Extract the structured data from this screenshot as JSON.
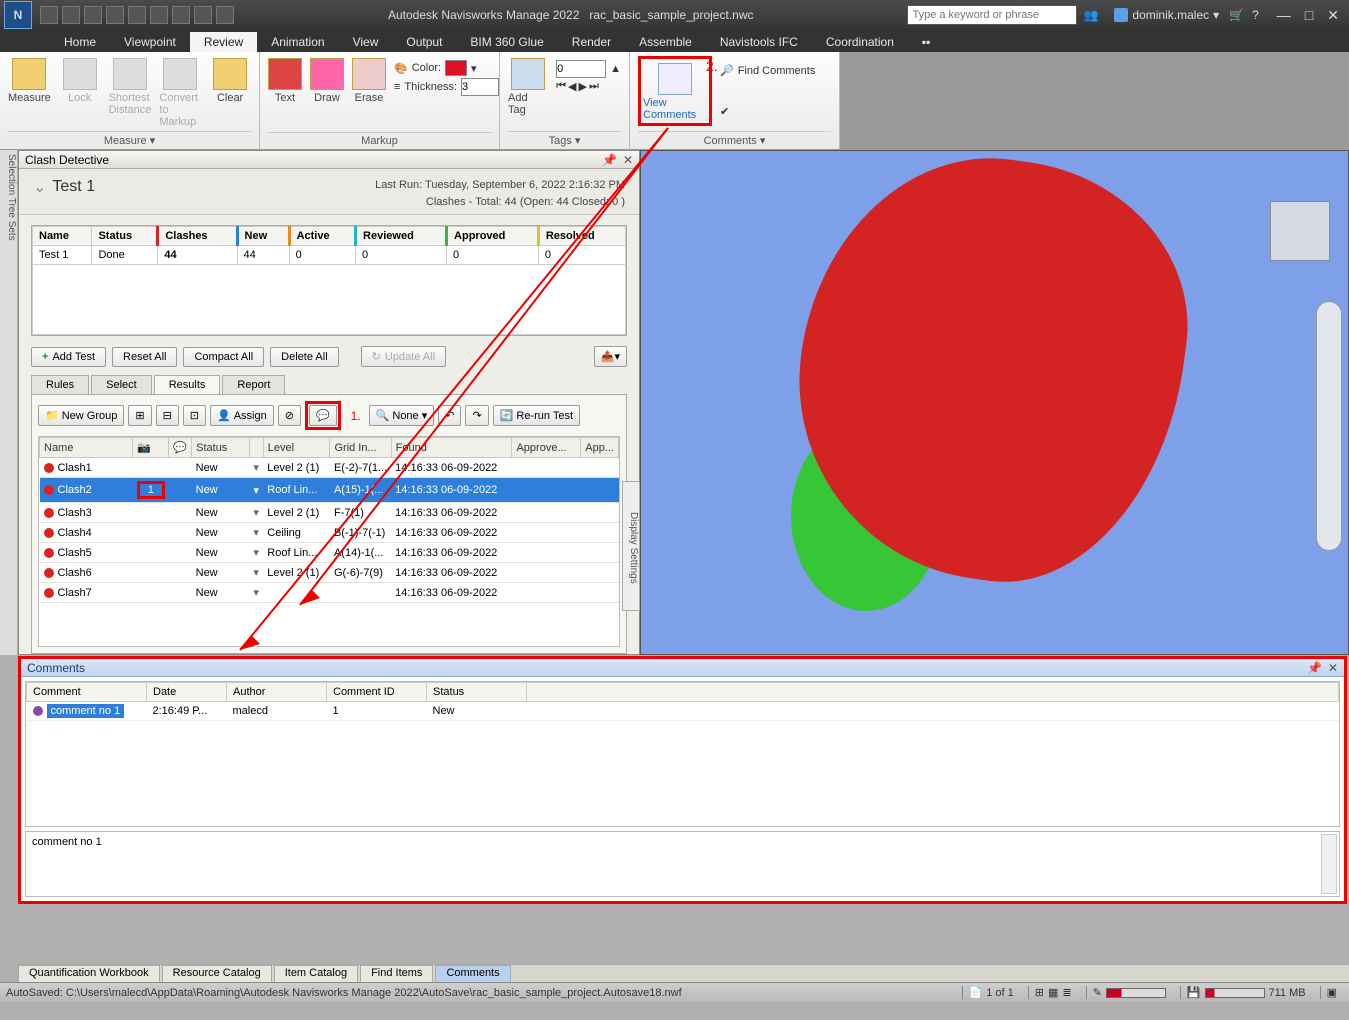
{
  "titlebar": {
    "app": "Autodesk Navisworks Manage 2022",
    "file": "rac_basic_sample_project.nwc",
    "search_placeholder": "Type a keyword or phrase",
    "user": "dominik.malec"
  },
  "menutabs": [
    "Home",
    "Viewpoint",
    "Review",
    "Animation",
    "View",
    "Output",
    "BIM 360 Glue",
    "Render",
    "Assemble",
    "Navistools IFC",
    "Coordination"
  ],
  "menutabs_active": "Review",
  "ribbon": {
    "measure": {
      "label": "Measure ▾",
      "btn_measure": "Measure",
      "btn_lock": "Lock",
      "btn_shortest": "Shortest Distance",
      "btn_convert": "Convert to Markup",
      "btn_clear": "Clear"
    },
    "markup": {
      "label": "Markup",
      "btn_text": "Text",
      "btn_draw": "Draw",
      "btn_erase": "Erase",
      "color": "Color:",
      "thickness": "Thickness:",
      "thickness_val": "3"
    },
    "tags": {
      "label": "Tags ▾",
      "btn_add": "Add Tag",
      "counter": "0"
    },
    "comments": {
      "label": "Comments ▾",
      "btn_view": "View Comments",
      "btn_find": "Find Comments"
    }
  },
  "side_strip": "Selection Tree   Sets",
  "clash": {
    "title": "Clash Detective",
    "test_name": "Test 1",
    "last_run": "Last Run:  Tuesday, September 6, 2022 2:16:32 PM",
    "totals": "Clashes - Total: 44  (Open: 44  Closed: 0 )",
    "summary_headers": [
      "Name",
      "Status",
      "Clashes",
      "New",
      "Active",
      "Reviewed",
      "Approved",
      "Resolved"
    ],
    "summary_row": [
      "Test 1",
      "Done",
      "44",
      "44",
      "0",
      "0",
      "0",
      "0"
    ],
    "btn_add": "Add Test",
    "btn_reset": "Reset All",
    "btn_compact": "Compact All",
    "btn_delete": "Delete All",
    "btn_update": "Update All",
    "tabs": [
      "Rules",
      "Select",
      "Results",
      "Report"
    ],
    "tabs_active": "Results",
    "btn_newgroup": "New Group",
    "btn_assign": "Assign",
    "btn_none": "None ▾",
    "btn_rerun": "Re-run Test",
    "grid_headers": [
      "Name",
      "📷",
      "💬",
      "Status",
      "",
      "Level",
      "Grid In...",
      "Found",
      "Approve...",
      "App..."
    ],
    "rows": [
      {
        "name": "Clash1",
        "cam": "",
        "c": "",
        "status": "New",
        "level": "Level 2 (1)",
        "grid": "E(-2)-7(1...",
        "found": "14:16:33 06-09-2022"
      },
      {
        "name": "Clash2",
        "cam": "1",
        "c": "",
        "status": "New",
        "level": "Roof Lin...",
        "grid": "A(15)-1(...",
        "found": "14:16:33 06-09-2022",
        "sel": true
      },
      {
        "name": "Clash3",
        "cam": "",
        "c": "",
        "status": "New",
        "level": "Level 2 (1)",
        "grid": "F-7(1)",
        "found": "14:16:33 06-09-2022"
      },
      {
        "name": "Clash4",
        "cam": "",
        "c": "",
        "status": "New",
        "level": "Ceiling",
        "grid": "B(-1)-7(-1)",
        "found": "14:16:33 06-09-2022"
      },
      {
        "name": "Clash5",
        "cam": "",
        "c": "",
        "status": "New",
        "level": "Roof Lin...",
        "grid": "A(14)-1(...",
        "found": "14:16:33 06-09-2022"
      },
      {
        "name": "Clash6",
        "cam": "",
        "c": "",
        "status": "New",
        "level": "Level 2 (1)",
        "grid": "G(-6)-7(9)",
        "found": "14:16:33 06-09-2022"
      },
      {
        "name": "Clash7",
        "cam": "",
        "c": "",
        "status": "New",
        "level": "",
        "grid": "",
        "found": "14:16:33 06-09-2022"
      }
    ],
    "display_settings": "Display Settings"
  },
  "comments_panel": {
    "title": "Comments",
    "headers": [
      "Comment",
      "Date",
      "Author",
      "Comment ID",
      "Status"
    ],
    "row": {
      "comment": "comment no 1",
      "date": "2:16:49 P...",
      "author": "malecd",
      "id": "1",
      "status": "New"
    },
    "detail": "comment no 1"
  },
  "bottom_tabs": [
    "Quantification Workbook",
    "Resource Catalog",
    "Item Catalog",
    "Find Items",
    "Comments"
  ],
  "bottom_tabs_active": "Comments",
  "status": {
    "autosave": "AutoSaved: C:\\Users\\malecd\\AppData\\Roaming\\Autodesk Navisworks Manage 2022\\AutoSave\\rac_basic_sample_project.Autosave18.nwf",
    "page": "1 of 1",
    "mem": "711 MB"
  },
  "annotations": {
    "a1": "1.",
    "a2": "2."
  }
}
